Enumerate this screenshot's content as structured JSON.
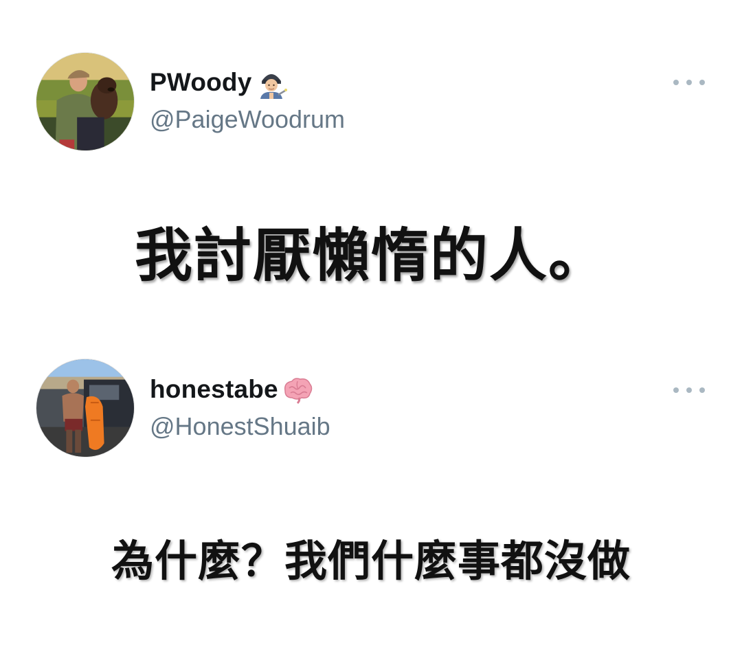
{
  "tweets": [
    {
      "display_name": "PWoody",
      "name_emoji": "technologist-emoji",
      "handle": "@PaigeWoodrum",
      "text": "我討厭懶惰的人。",
      "more_icon": "ellipsis-icon"
    },
    {
      "display_name": "honestabe",
      "name_emoji": "brain-emoji",
      "handle": "@HonestShuaib",
      "text": "為什麼？我們什麼事都沒做",
      "more_icon": "ellipsis-icon"
    }
  ],
  "colors": {
    "name": "#14171a",
    "handle": "#657786",
    "more_dots": "#aab8c2",
    "background": "#ffffff",
    "brain": "#f4a3b5"
  }
}
